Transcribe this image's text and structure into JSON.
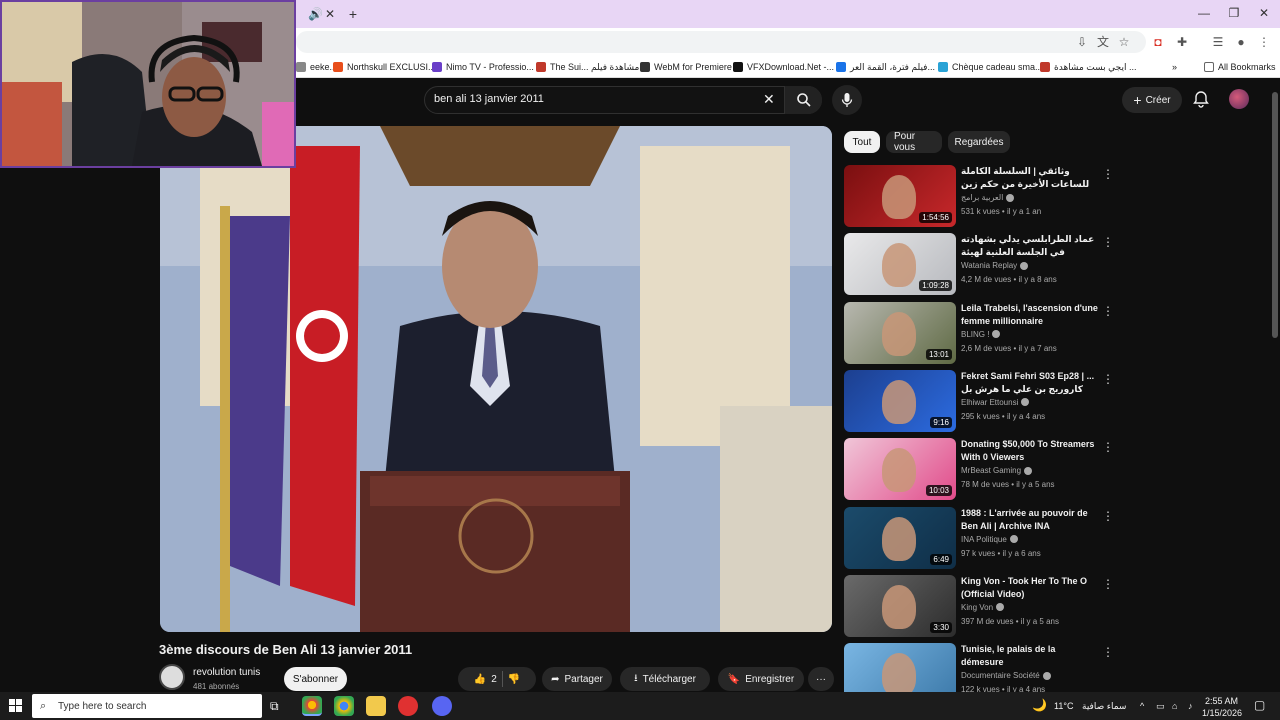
{
  "browser": {
    "bookmarks": [
      {
        "label": "eeke...",
        "color": "#888888"
      },
      {
        "label": "Northskull EXCLUSI...",
        "color": "#e84e1b"
      },
      {
        "label": "Nimo TV - Professio...",
        "color": "#6a3fc8"
      },
      {
        "label": "The Sui... مشاهدة فيلم",
        "color": "#c0392b"
      },
      {
        "label": "WebM for Premiere",
        "color": "#333333"
      },
      {
        "label": "VFXDownload.Net -...",
        "color": "#111111"
      },
      {
        "label": "فيلم فترة، القمة العر...",
        "color": "#1a73e8"
      },
      {
        "label": "Chèque cadeau sma...",
        "color": "#2aa3d6"
      },
      {
        "label": "ايجي بست مشاهدة ...",
        "color": "#c0392b"
      }
    ],
    "all_bookmarks_label": "All Bookmarks",
    "more_label": "»"
  },
  "header": {
    "search_query": "ben ali 13 janvier 2011",
    "create_label": "Créer"
  },
  "video": {
    "title": "3ème discours de Ben Ali 13 janvier 2011",
    "channel_name": "revolution tunis",
    "subscribers": "481 abonnés",
    "subscribe_label": "S'abonner",
    "like_count": "2",
    "share_label": "Partager",
    "download_label": "Télécharger",
    "save_label": "Enregistrer",
    "more_label": "···"
  },
  "chips": [
    {
      "label": "Tout",
      "active": true
    },
    {
      "label": "Pour vous",
      "active": false
    },
    {
      "label": "Regardées",
      "active": false
    }
  ],
  "recommendations": [
    {
      "title": "وثائقي | السلسلة الكاملة للساعات الأخيرة من حكم زين العابدين بن علي من قرطاج",
      "channel": "العربية برامج",
      "meta": "531 k vues • il y a 1 an",
      "duration": "1:54:56",
      "colors": [
        "#7a0f10",
        "#c8282b"
      ]
    },
    {
      "title": "عماد الطرابلسي يدلي بشهادته في الجلسة العلنية لهيئة الحقيقة والكرامة",
      "channel": "Watania Replay",
      "meta": "4,2 M de vues • il y a 8 ans",
      "duration": "1:09:28",
      "colors": [
        "#e9e9ea",
        "#b7b9be"
      ]
    },
    {
      "title": "Leila Trabelsi, l'ascension d'une femme millionnaire",
      "channel": "BLING !",
      "meta": "2,6 M de vues • il y a 7 ans",
      "duration": "13:01",
      "colors": [
        "#b8b8b0",
        "#5f6a44"
      ]
    },
    {
      "title": "Fekret Sami Fehri S03 Ep28 | ... كاروريج بن علي ما هرش بل كالمكس خلي",
      "channel": "Elhiwar Ettounsi",
      "meta": "295 k vues • il y a 4 ans",
      "duration": "9:16",
      "colors": [
        "#1c3f8f",
        "#2c6be0"
      ]
    },
    {
      "title": "Donating $50,000 To Streamers With 0 Viewers",
      "channel": "MrBeast Gaming",
      "meta": "78 M de vues • il y a 5 ans",
      "duration": "10:03",
      "colors": [
        "#f0c6d8",
        "#e14b8a"
      ]
    },
    {
      "title": "1988 : L'arrivée au pouvoir de Ben Ali | Archive INA",
      "channel": "INA Politique",
      "meta": "97 k vues • il y a 6 ans",
      "duration": "6:49",
      "colors": [
        "#1b4b6b",
        "#0f2e47"
      ]
    },
    {
      "title": "King Von - Took Her To The O (Official Video)",
      "channel": "King Von",
      "meta": "397 M de vues • il y a 5 ans",
      "duration": "3:30",
      "colors": [
        "#6a6a6a",
        "#2c2c2c"
      ]
    },
    {
      "title": "Tunisie, le palais de la démesure",
      "channel": "Documentaire Société",
      "meta": "122 k vues • il y a 4 ans",
      "duration": "",
      "colors": [
        "#7ab6e3",
        "#3b78a8"
      ]
    }
  ],
  "taskbar": {
    "search_placeholder": "Type here to search",
    "weather": "11°C",
    "weather_desc": "سماء صافية",
    "time": "2:55 AM",
    "date": "1/15/2026"
  }
}
